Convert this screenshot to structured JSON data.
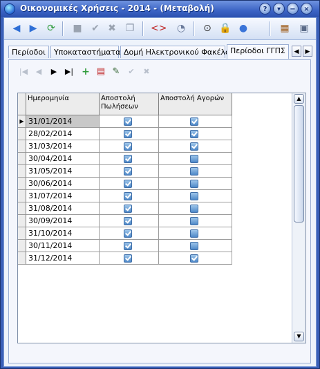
{
  "window": {
    "title": "Οικονομικές Χρήσεις - 2014 - (Μεταβολή)",
    "controls": [
      "?",
      "▾",
      "−",
      "×"
    ]
  },
  "toolbar": {
    "buttons": [
      {
        "name": "back-arrow-icon",
        "glyph": "◀",
        "color": "#2f6fd6"
      },
      {
        "name": "forward-arrow-icon",
        "glyph": "▶",
        "color": "#2f6fd6"
      },
      {
        "name": "refresh-icon",
        "glyph": "⟳",
        "color": "#2e9b3a"
      },
      {
        "name": "delete-icon",
        "glyph": "■",
        "color": "#9aa3b0"
      },
      {
        "name": "confirm-check-icon",
        "glyph": "✔",
        "color": "#9aa3b0"
      },
      {
        "name": "cancel-x-icon",
        "glyph": "✖",
        "color": "#9aa3b0"
      },
      {
        "name": "copy-icon",
        "glyph": "❐",
        "color": "#8b96a8"
      },
      {
        "name": "code-brackets-icon",
        "glyph": "<>",
        "color": "#c02828"
      },
      {
        "name": "history-icon",
        "glyph": "◔",
        "color": "#6a7a9a"
      },
      {
        "name": "binoculars-icon",
        "glyph": "⊙",
        "color": "#333"
      },
      {
        "name": "lock-icon",
        "glyph": "🔒",
        "color": "#c08010"
      },
      {
        "name": "user-settings-icon",
        "glyph": "●",
        "color": "#3a74d8"
      },
      {
        "name": "calendar-icon",
        "glyph": "▦",
        "color": "#a06020"
      },
      {
        "name": "window-options-icon",
        "glyph": "▣",
        "color": "#5a6a88"
      }
    ]
  },
  "tabs": [
    {
      "label": "Περίοδοι"
    },
    {
      "label": "Υποκαταστήματα"
    },
    {
      "label": "Δομή Ηλεκτρονικού Φακέλου"
    },
    {
      "label": "Περίοδοι ΓΓΠΣ"
    }
  ],
  "tab_nav": {
    "prev": "◀",
    "next": "▶"
  },
  "navigator": [
    "|◀",
    "◀",
    "▶",
    "▶|"
  ],
  "grid": {
    "columns": [
      {
        "label": "Ημερομηνία"
      },
      {
        "label": "Αποστολή Πωλήσεων"
      },
      {
        "label": "Αποστολή Αγορών"
      }
    ],
    "rows": [
      {
        "date": "31/01/2014",
        "sales": true,
        "purchases": true
      },
      {
        "date": "28/02/2014",
        "sales": true,
        "purchases": true
      },
      {
        "date": "31/03/2014",
        "sales": true,
        "purchases": true
      },
      {
        "date": "30/04/2014",
        "sales": true,
        "purchases": false
      },
      {
        "date": "31/05/2014",
        "sales": true,
        "purchases": false
      },
      {
        "date": "30/06/2014",
        "sales": true,
        "purchases": false
      },
      {
        "date": "31/07/2014",
        "sales": true,
        "purchases": false
      },
      {
        "date": "31/08/2014",
        "sales": true,
        "purchases": false
      },
      {
        "date": "30/09/2014",
        "sales": true,
        "purchases": false
      },
      {
        "date": "31/10/2014",
        "sales": true,
        "purchases": false
      },
      {
        "date": "30/11/2014",
        "sales": true,
        "purchases": false
      },
      {
        "date": "31/12/2014",
        "sales": true,
        "purchases": true
      }
    ]
  },
  "scrollbar": {
    "up": "▲",
    "down": "▼"
  }
}
